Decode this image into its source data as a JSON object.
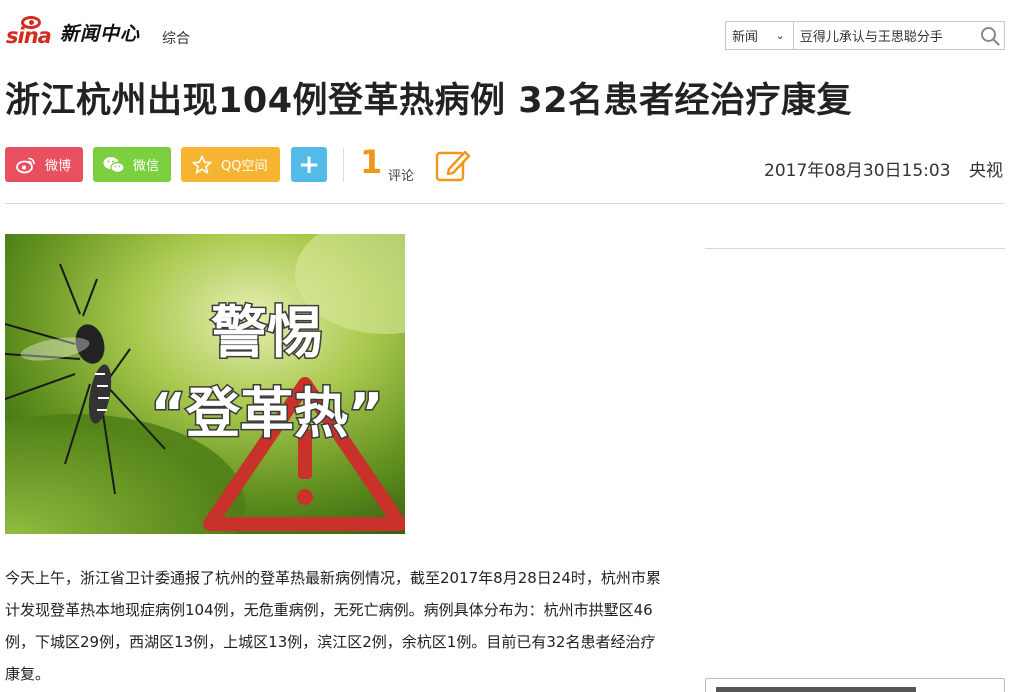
{
  "header": {
    "logo_brand": "sina",
    "logo_text": "新闻中心",
    "channel": "综合",
    "search": {
      "category": "新闻",
      "query": "豆得儿承认与王思聪分手"
    }
  },
  "article": {
    "title": "浙江杭州出现104例登革热病例 32名患者经治疗康复",
    "share": {
      "weibo": "微博",
      "wechat": "微信",
      "qzone": "QQ空间",
      "more": "+"
    },
    "comments": {
      "count": "1",
      "label": "评论"
    },
    "date": "2017年08月30日15:03",
    "source": "央视",
    "image": {
      "line1": "警惕",
      "line2": "“登革热”"
    },
    "body": "今天上午，浙江省卫计委通报了杭州的登革热最新病例情况，截至2017年8月28日24时，杭州市累计发现登革热本地现症病例104例，无危重病例，无死亡病例。病例具体分布为：杭州市拱墅区46例，下城区29例，西湖区13例，上城区13例，滨江区2例，余杭区1例。目前已有32名患者经治疗康复。"
  },
  "colors": {
    "brand_red": "#d52b1e",
    "weibo": "#e8505f",
    "wechat": "#7ccf3f",
    "qzone": "#f5b533",
    "more": "#52bbe8",
    "comment_accent": "#f0961a"
  },
  "icons": [
    "weibo-icon",
    "wechat-icon",
    "qzone-star-icon",
    "search-icon",
    "edit-icon",
    "warning-triangle-icon",
    "mosquito-icon"
  ]
}
